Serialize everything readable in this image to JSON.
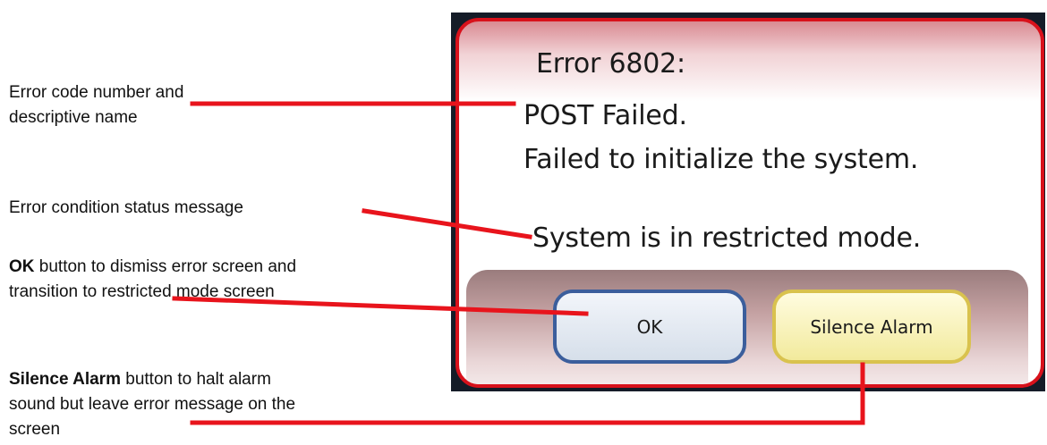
{
  "annotations": {
    "error_code": "Error code number and descriptive name",
    "status_message": "Error condition status message",
    "ok_bold": "OK",
    "ok_rest": " button to dismiss error screen and transition to restricted mode screen",
    "silence_bold": "Silence Alarm",
    "silence_rest": " button to halt alarm sound but leave error message on the screen"
  },
  "dialog": {
    "error_code": "Error 6802:",
    "error_name": "POST Failed.",
    "error_detail": "Failed to initialize the system.",
    "status_message": "System is in restricted mode.",
    "ok_label": "OK",
    "silence_label": "Silence Alarm"
  },
  "colors": {
    "callout_line": "#e8141c",
    "dialog_border": "#d8111b",
    "ok_border": "#3b5e9c",
    "silence_border": "#d9c24e"
  }
}
